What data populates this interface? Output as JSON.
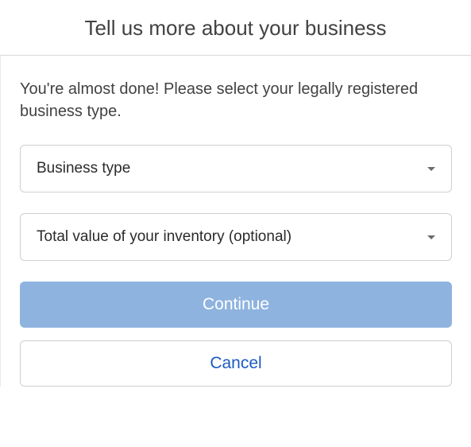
{
  "header": {
    "title": "Tell us more about your business"
  },
  "body": {
    "instruction": "You're almost done! Please select your legally registered business type.",
    "businessTypeDropdown": {
      "label": "Business type"
    },
    "inventoryDropdown": {
      "label": "Total value of your inventory (optional)"
    },
    "continueButton": "Continue",
    "cancelButton": "Cancel"
  }
}
